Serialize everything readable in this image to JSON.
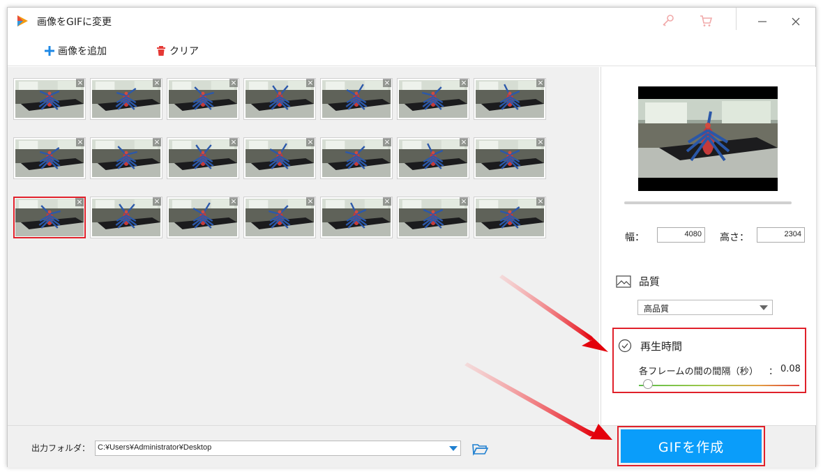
{
  "window": {
    "title": "画像をGIFに変更"
  },
  "toolbar": {
    "add_label": "画像を追加",
    "clear_label": "クリア"
  },
  "thumbnails": {
    "rows": 3,
    "cols": 7,
    "close_glyph": "×",
    "selected_index": 14
  },
  "properties": {
    "width_label": "幅：",
    "width_value": "4080",
    "height_label": "高さ：",
    "height_value": "2304",
    "quality_label": "品質",
    "quality_selected": "高品質",
    "playback_label": "再生時間",
    "interval_label": "各フレームの間の間隔（秒）",
    "interval_separator": "：",
    "interval_value": "0.08"
  },
  "footer": {
    "output_label": "出力フォルダ：",
    "output_path": "C:¥Users¥Administrator¥Desktop",
    "create_label": "GIFを作成"
  },
  "colors": {
    "accent": "#0a9dfa",
    "highlight": "#e0202a",
    "panel": "#f0f0f0"
  },
  "icons": [
    "app-logo-icon",
    "key-icon",
    "cart-icon",
    "minimize-icon",
    "close-icon",
    "plus-icon",
    "trash-icon",
    "image-icon",
    "clock-icon",
    "folder-icon",
    "chevron-down-icon"
  ]
}
